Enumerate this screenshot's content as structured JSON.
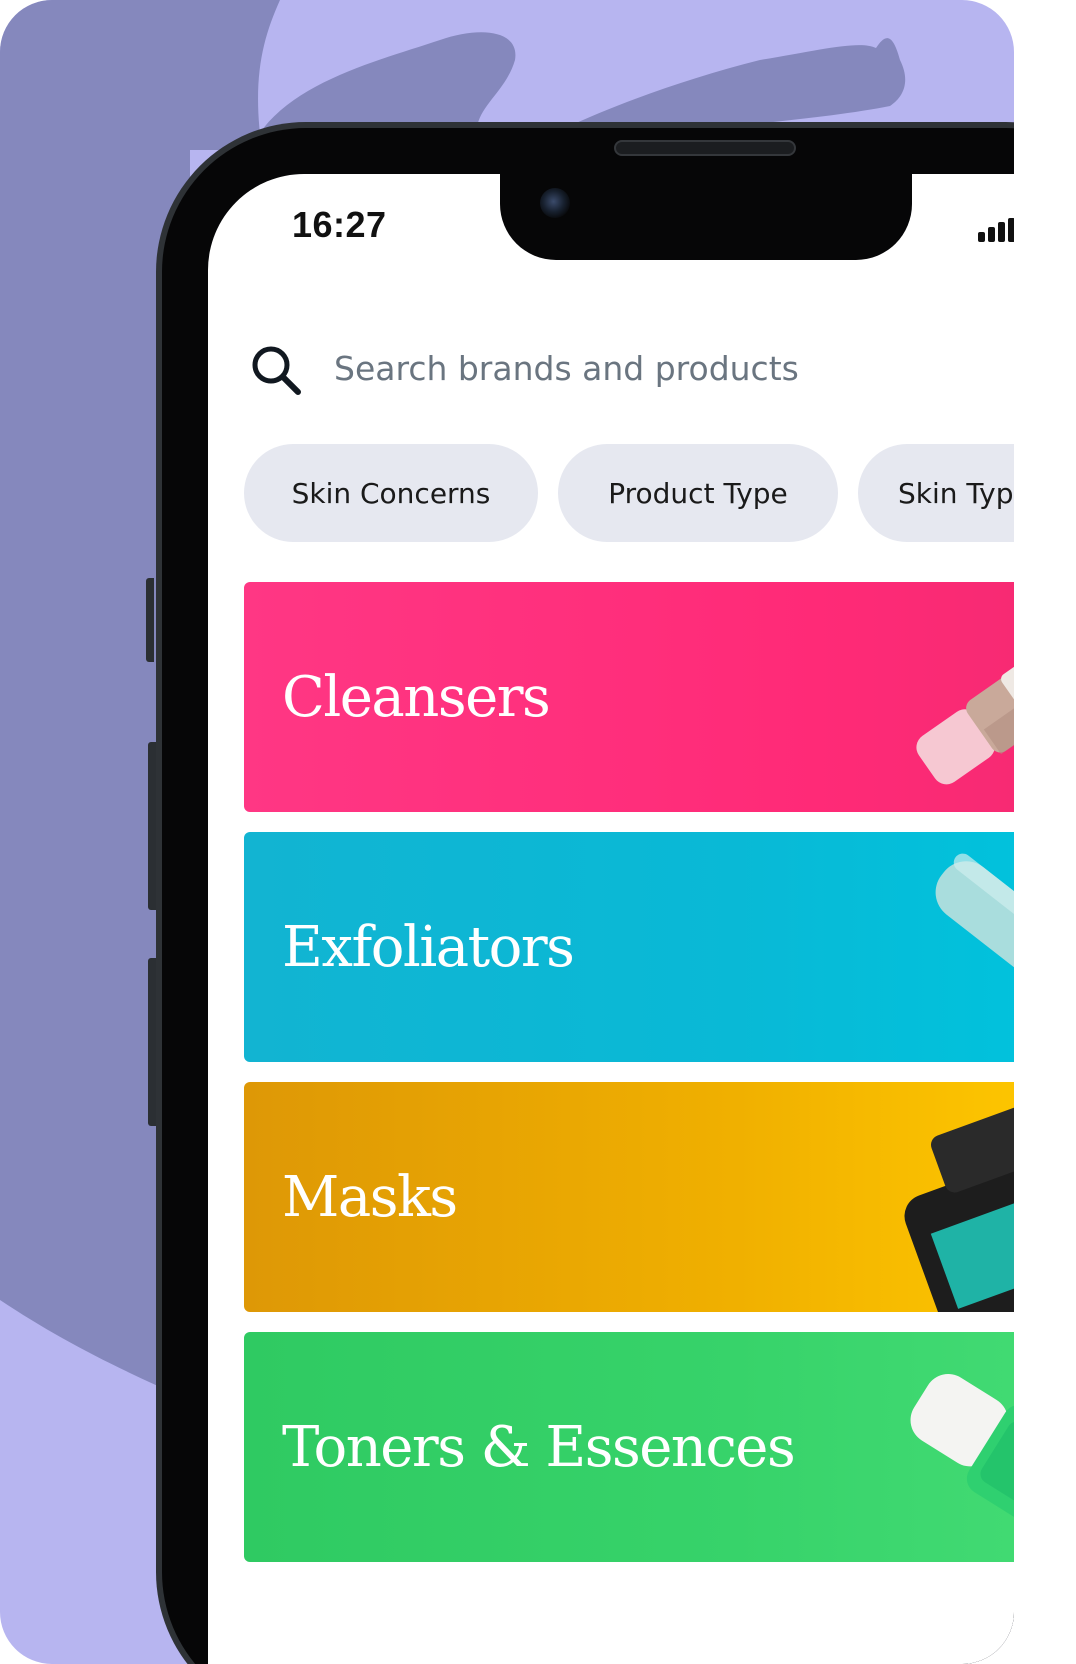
{
  "status_bar": {
    "time": "16:27"
  },
  "search": {
    "placeholder": "Search brands and products"
  },
  "filters": [
    {
      "label": "Skin Concerns"
    },
    {
      "label": "Product Type"
    },
    {
      "label": "Skin Type"
    }
  ],
  "categories": [
    {
      "name": "Cleansers",
      "color": "#ff2e7d"
    },
    {
      "name": "Exfoliators",
      "color": "#10b8d4"
    },
    {
      "name": "Masks",
      "color": "#f0ad08"
    },
    {
      "name": "Toners & Essences",
      "color": "#33d06a"
    }
  ]
}
